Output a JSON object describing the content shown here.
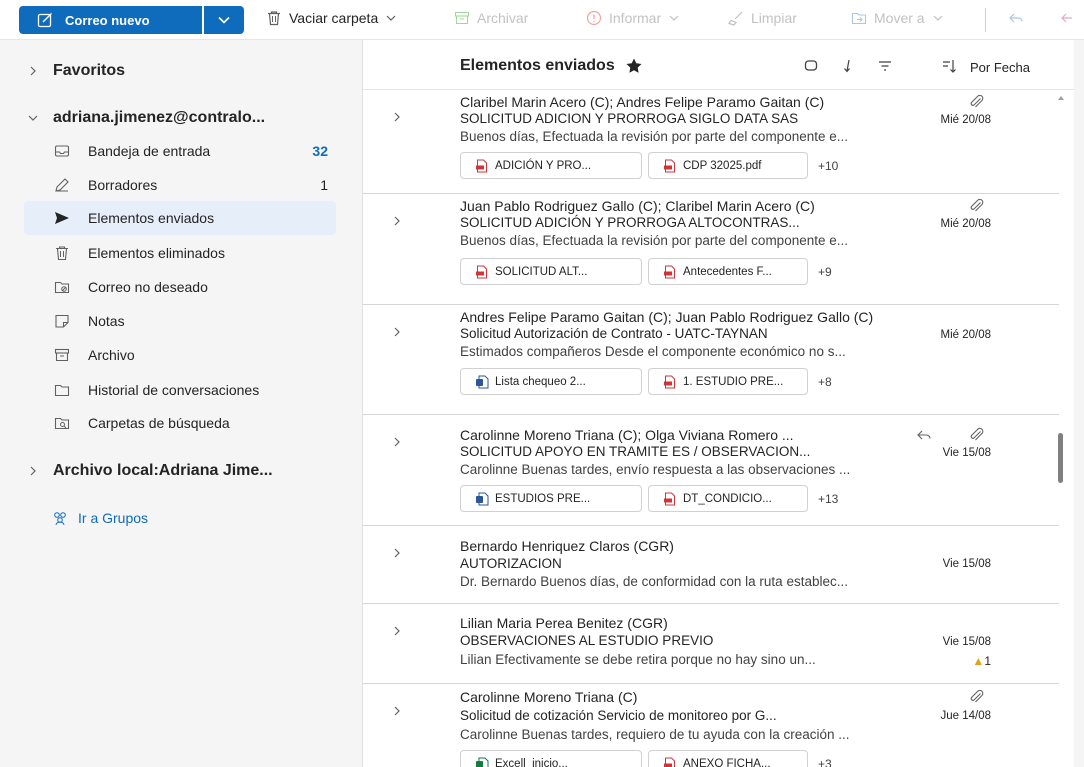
{
  "toolbar": {
    "new_mail": "Correo nuevo",
    "empty_folder": "Vaciar carpeta",
    "archive": "Archivar",
    "report": "Informar",
    "sweep": "Limpiar",
    "move_to": "Mover a"
  },
  "sidebar": {
    "favorites": "Favoritos",
    "account": "adriana.jimenez@contralo...",
    "folders": [
      {
        "label": "Bandeja de entrada",
        "count": "32",
        "icon": "inbox-icon"
      },
      {
        "label": "Borradores",
        "count": "1",
        "icon": "pencil-icon"
      },
      {
        "label": "Elementos enviados",
        "count": "",
        "icon": "send-icon"
      },
      {
        "label": "Elementos eliminados",
        "count": "",
        "icon": "trash-icon"
      },
      {
        "label": "Correo no deseado",
        "count": "",
        "icon": "junk-icon"
      },
      {
        "label": "Notas",
        "count": "",
        "icon": "note-icon"
      },
      {
        "label": "Archivo",
        "count": "",
        "icon": "archive-icon"
      },
      {
        "label": "Historial de conversaciones",
        "count": "",
        "icon": "folder-icon"
      },
      {
        "label": "Carpetas de búsqueda",
        "count": "",
        "icon": "search-folder-icon"
      }
    ],
    "local_archive": "Archivo local:Adriana Jime...",
    "groups_link": "Ir a Grupos"
  },
  "list": {
    "title": "Elementos enviados",
    "sort_label": "Por Fecha",
    "messages": [
      {
        "from": "Claribel Marin Acero (C); Andres Felipe Paramo Gaitan (C)",
        "subject": "SOLICITUD ADICION Y PRORROGA SIGLO DATA SAS",
        "date": "Mié 20/08",
        "preview": "Buenos días, Efectuada la revisión por parte del componente e...",
        "attachments": [
          "ADICIÓN Y PRO...",
          "CDP 32025.pdf"
        ],
        "more": "+10"
      },
      {
        "from": "Juan Pablo Rodriguez Gallo (C); Claribel Marin Acero (C)",
        "subject": "SOLICITUD ADICIÓN Y PRORROGA ALTOCONTRAS...",
        "date": "Mié 20/08",
        "preview": "Buenos días, Efectuada la revisión por parte del componente e...",
        "attachments": [
          "SOLICITUD ALT...",
          "Antecedentes F..."
        ],
        "more": "+9"
      },
      {
        "from": "Andres Felipe Paramo Gaitan (C); Juan Pablo Rodriguez Gallo (C)",
        "subject": "Solicitud Autorización de Contrato - UATC-TAYNAN",
        "date": "Mié 20/08",
        "preview": "Estimados compañeros Desde el componente económico no s...",
        "attachments": [
          "Lista chequeo 2...",
          "1. ESTUDIO PRE..."
        ],
        "more": "+8"
      },
      {
        "from": "Carolinne Moreno Triana (C); Olga Viviana Romero ...",
        "subject": "SOLICITUD APOYO EN TRAMITE ES / OBSERVACION...",
        "date": "Vie 15/08",
        "preview": "Carolinne Buenas tardes, envío respuesta a las observaciones ...",
        "attachments": [
          "ESTUDIOS PRE...",
          "DT_CONDICIO..."
        ],
        "more": "+13"
      },
      {
        "from": "Bernardo Henriquez Claros (CGR)",
        "subject": "AUTORIZACION",
        "date": "Vie 15/08",
        "preview": "Dr. Bernardo Buenos días, de conformidad con la ruta establec..."
      },
      {
        "from": "Lilian Maria Perea Benitez (CGR)",
        "subject": "OBSERVACIONES AL ESTUDIO PREVIO",
        "date": "Vie 15/08",
        "preview": "Lilian Efectivamente se debe retira porque no hay sino un...",
        "reaction": "1"
      },
      {
        "from": "Carolinne Moreno Triana (C)",
        "subject": "Solicitud de cotización Servicio de monitoreo por G...",
        "date": "Jue 14/08",
        "preview": "Carolinne Buenas tardes, requiero de tu ayuda con la creación ...",
        "attachments": [
          "Excell_inicio...",
          "ANEXO FICHA..."
        ],
        "more": "+3"
      }
    ]
  }
}
